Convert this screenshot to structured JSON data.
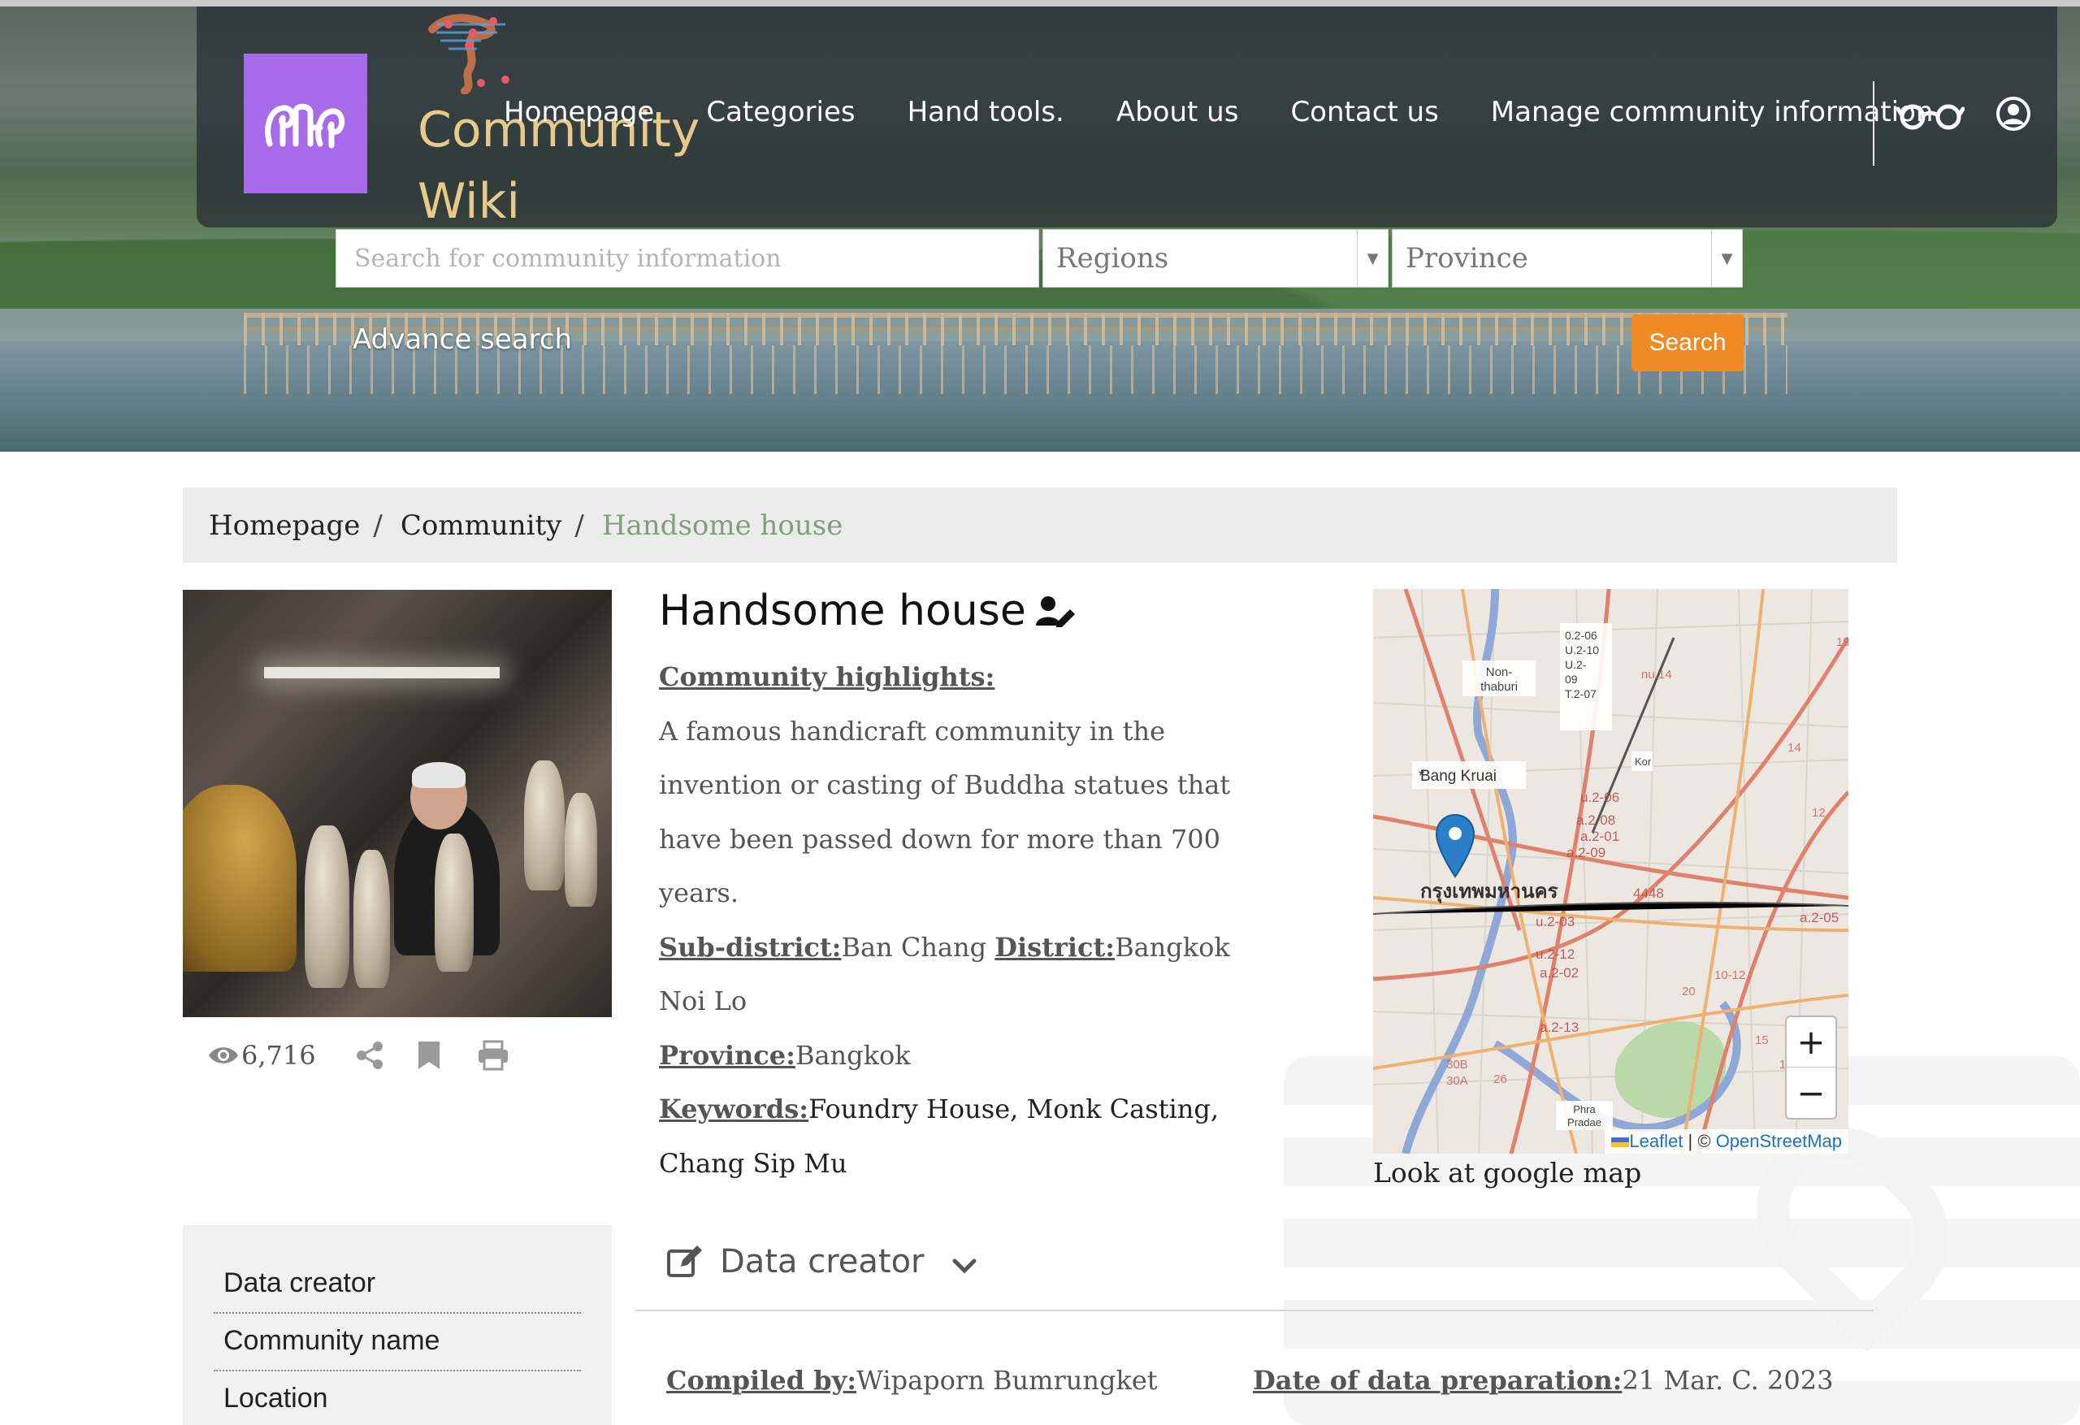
{
  "brand": {
    "line1": "Community",
    "line2": "Wiki"
  },
  "nav": {
    "items": [
      {
        "label": "Homepage"
      },
      {
        "label": "Categories"
      },
      {
        "label": "Hand tools."
      },
      {
        "label": "About us"
      },
      {
        "label": "Contact us"
      },
      {
        "label": "Manage community information"
      }
    ]
  },
  "search": {
    "placeholder": "Search for community information",
    "regions": "Regions",
    "province": "Province",
    "advance": "Advance search",
    "button": "Search"
  },
  "breadcrumb": {
    "items": [
      {
        "label": "Homepage"
      },
      {
        "label": "Community"
      }
    ],
    "current": "Handsome house"
  },
  "stats": {
    "views": "6,716"
  },
  "community": {
    "title": "Handsome house",
    "highlights_label": "Community highlights:",
    "highlights_text": "A famous handicraft community in the invention or casting of Buddha statues that have been passed down for more than 700 years.",
    "subdistrict_label": "Sub-district:",
    "subdistrict": "Ban Chang",
    "district_label": "District:",
    "district": "Bangkok Noi Lo",
    "province_label": "Province:",
    "province": "Bangkok",
    "keywords_label": "Keywords:",
    "keywords": "Foundry House, Monk Casting, Chang Sip Mu"
  },
  "map": {
    "caption": "Look at google map",
    "zoom_in": "+",
    "zoom_out": "−",
    "attribution_leaflet": "Leaflet",
    "attribution_sep": " | © ",
    "attribution_osm": "OpenStreetMap",
    "labels": {
      "nonthaburi": "Non-\nthaburi",
      "bang_kruai": "Bang Kruai",
      "bangkok": "กรุงเทพมหานคร",
      "phra_pradaeng": "Phra\nPradae",
      "kor": "Kor",
      "roads_box": "0.2-06\nU.2-10\nU.2-\n09\nT.2-07"
    },
    "colors": {
      "road_red": "#e0826b",
      "road_orange": "#f0b070",
      "river": "#8fa8d8",
      "park": "#b9d9a8",
      "marker": "#2a7fc8"
    }
  },
  "sidebar": {
    "items": [
      {
        "label": "Data creator"
      },
      {
        "label": "Community name"
      },
      {
        "label": "Location"
      }
    ]
  },
  "data_creator": {
    "heading": "Data creator",
    "compiled_label": "Compiled by:",
    "compiled": "Wipaporn Bumrungket",
    "date_label": "Date of data preparation:",
    "date": "21 Mar. C. 2023"
  },
  "colors": {
    "accent": "#f08a24",
    "logo_bg": "#a66be8",
    "brand_text": "#e8c98a",
    "breadcrumb_active": "#7fa07a"
  }
}
